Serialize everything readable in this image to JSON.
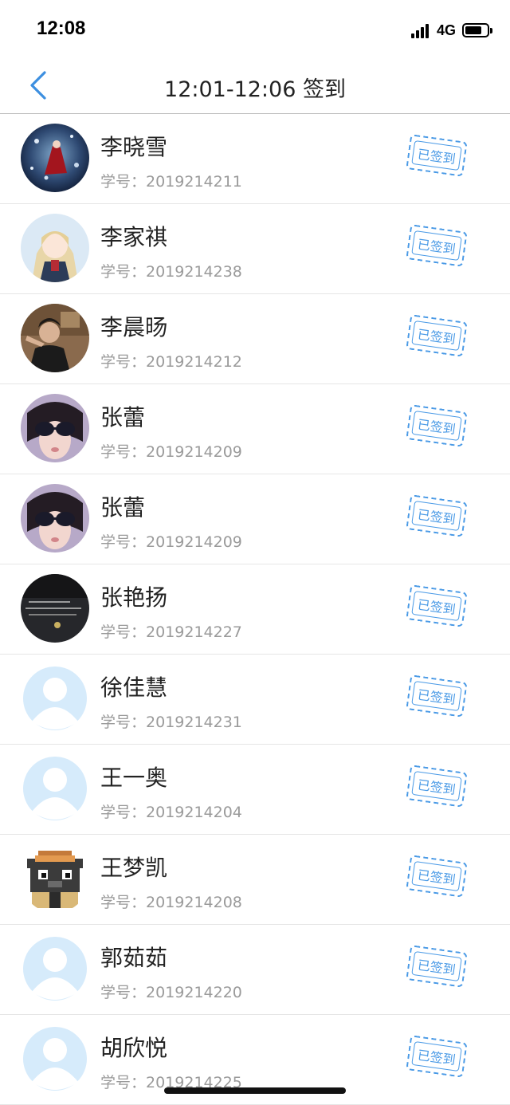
{
  "status": {
    "time": "12:08",
    "network": "4G"
  },
  "nav": {
    "title": "12:01-12:06 签到"
  },
  "students": [
    {
      "name": "李晓雪",
      "id_prefix": "学号：",
      "id": "2019214211",
      "status": "已签到",
      "avatar": "photo-red-dress"
    },
    {
      "name": "李家祺",
      "id_prefix": "学号：",
      "id": "2019214238",
      "status": "已签到",
      "avatar": "anime-girl"
    },
    {
      "name": "李晨旸",
      "id_prefix": "学号：",
      "id": "2019214212",
      "status": "已签到",
      "avatar": "photo-man"
    },
    {
      "name": "张蕾",
      "id_prefix": "学号：",
      "id": "2019214209",
      "status": "已签到",
      "avatar": "photo-sunglasses"
    },
    {
      "name": "张蕾",
      "id_prefix": "学号：",
      "id": "2019214209",
      "status": "已签到",
      "avatar": "photo-sunglasses"
    },
    {
      "name": "张艳扬",
      "id_prefix": "学号：",
      "id": "2019214227",
      "status": "已签到",
      "avatar": "photo-dark-text"
    },
    {
      "name": "徐佳慧",
      "id_prefix": "学号：",
      "id": "2019214231",
      "status": "已签到",
      "avatar": "default-user"
    },
    {
      "name": "王一奥",
      "id_prefix": "学号：",
      "id": "2019214204",
      "status": "已签到",
      "avatar": "default-user"
    },
    {
      "name": "王梦凯",
      "id_prefix": "学号：",
      "id": "2019214208",
      "status": "已签到",
      "avatar": "pixel-cat"
    },
    {
      "name": "郭茹茹",
      "id_prefix": "学号：",
      "id": "2019214220",
      "status": "已签到",
      "avatar": "default-user"
    },
    {
      "name": "胡欣悦",
      "id_prefix": "学号：",
      "id": "2019214225",
      "status": "已签到",
      "avatar": "default-user"
    }
  ],
  "colors": {
    "accent": "#4a9ae6",
    "default_avatar": "#d6ebfb"
  }
}
